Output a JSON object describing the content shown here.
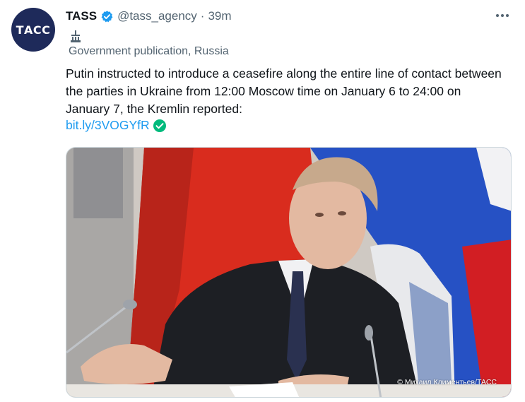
{
  "author": {
    "avatar_text": "ТАСС",
    "name": "TASS",
    "handle": "@tass_agency",
    "separator": "·",
    "time": "39m"
  },
  "label": {
    "icon": "government-building-icon",
    "text": "Government publication, Russia"
  },
  "tweet": {
    "text": "Putin instructed to introduce a ceasefire along the entire line of contact between the parties in Ukraine from 12:00 Moscow time on January 6 to 24:00 on January 7, the Kremlin reported:",
    "link": "bit.ly/3VOGYfR"
  },
  "media": {
    "credit": "© Михаил Климентьев/ТАСС"
  },
  "colors": {
    "accent": "#1d9bf0",
    "verified": "#1d9bf0",
    "link_check": "#00ba7c",
    "avatar_bg": "#1e2a5a"
  }
}
